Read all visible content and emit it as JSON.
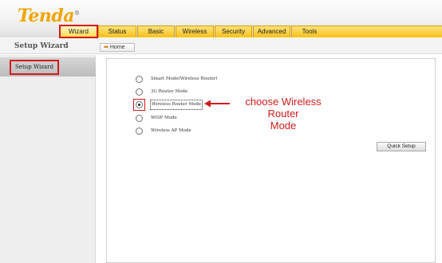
{
  "logo": {
    "name": "Tenda",
    "mark": "®"
  },
  "tabs": [
    {
      "label": "Wizard",
      "active": true
    },
    {
      "label": "Status"
    },
    {
      "label": "Basic"
    },
    {
      "label": "Wireless"
    },
    {
      "label": "Security"
    },
    {
      "label": "Advanced"
    },
    {
      "label": "Tools"
    }
  ],
  "subbar": {
    "title": "Setup Wizard",
    "home_label": "Home"
  },
  "sidebar": {
    "items": [
      {
        "label": "Setup Wizard",
        "highlighted": true
      }
    ]
  },
  "options": [
    {
      "label": "Smart Mode(Wireless Router)",
      "checked": false
    },
    {
      "label": "3G Router Mode",
      "checked": false
    },
    {
      "label": "Wireless Router Mode",
      "checked": true
    },
    {
      "label": "WISP Mode",
      "checked": false
    },
    {
      "label": "Wireless AP Mode",
      "checked": false
    }
  ],
  "annotation": {
    "line1": "choose Wireless Router",
    "line2": "Mode",
    "color": "#d21b1b"
  },
  "quick_setup_label": "Quick Setup",
  "colors": {
    "tab_yellow": "#f7c01a",
    "highlight_red": "#d21b1b",
    "logo_orange": "#f0a500"
  }
}
